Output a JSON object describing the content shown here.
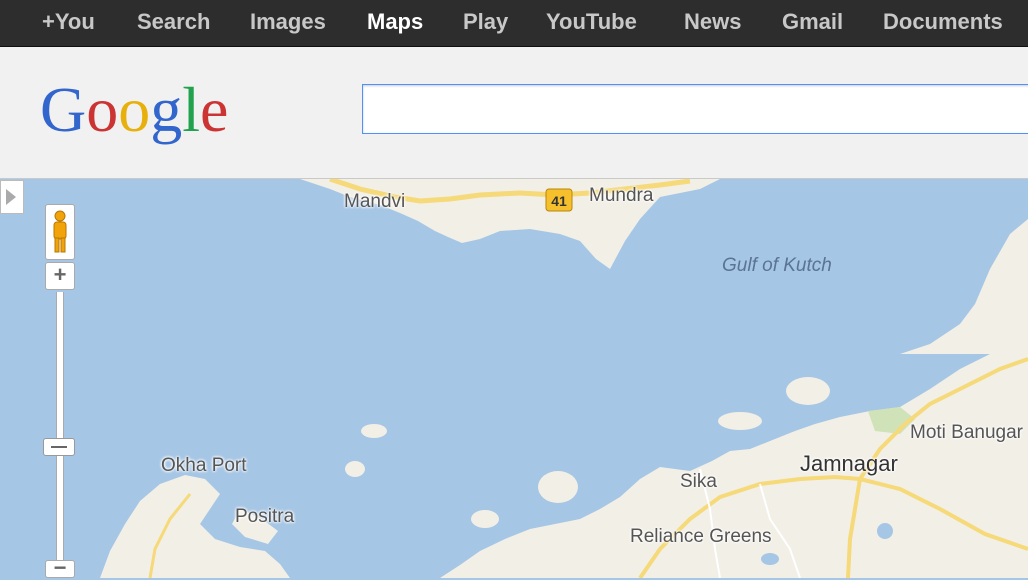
{
  "nav": {
    "items": [
      {
        "label": "+You",
        "active": false
      },
      {
        "label": "Search",
        "active": false
      },
      {
        "label": "Images",
        "active": false
      },
      {
        "label": "Maps",
        "active": true
      },
      {
        "label": "Play",
        "active": false
      },
      {
        "label": "YouTube",
        "active": false
      },
      {
        "label": "News",
        "active": false
      },
      {
        "label": "Gmail",
        "active": false
      },
      {
        "label": "Documents",
        "active": false
      }
    ]
  },
  "logo": {
    "text": "Google",
    "colors": [
      "#3366cc",
      "#cc3333",
      "#e8b00c",
      "#3366cc",
      "#22a24f",
      "#cc3333"
    ]
  },
  "search": {
    "value": ""
  },
  "map": {
    "water_color": "#a6c6e5",
    "land_color": "#f2efe6",
    "road_color": "#f6d978",
    "highway_shield": "41",
    "places": {
      "mandvi": "Mandvi",
      "mundra": "Mundra",
      "gulf": "Gulf of Kutch",
      "okha": "Okha Port",
      "positra": "Positra",
      "sika": "Sika",
      "jamnagar": "Jamnagar",
      "moti": "Moti Banugar",
      "reliance": "Reliance Greens"
    }
  },
  "controls": {
    "zoom_in": "+",
    "zoom_out": "−"
  }
}
